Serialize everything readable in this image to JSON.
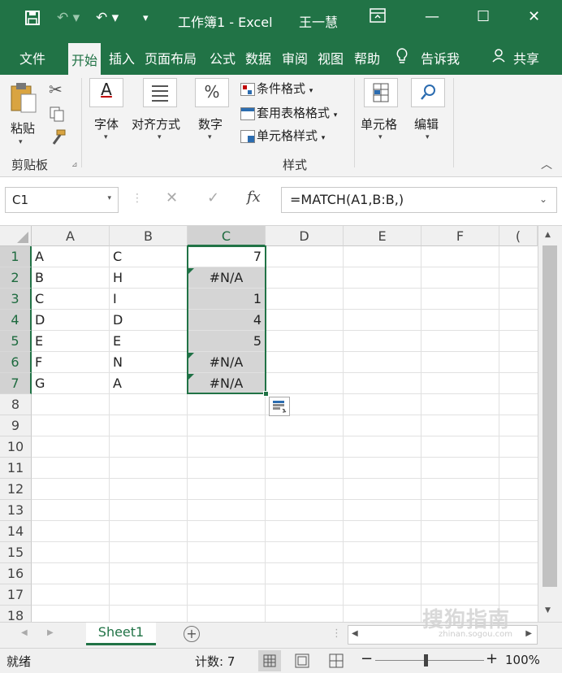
{
  "titlebar": {
    "title": "工作簿1  -  Excel",
    "user": "王一慧",
    "accent": "#217346"
  },
  "tabs": [
    {
      "label": "文件"
    },
    {
      "label": "开始"
    },
    {
      "label": "插入"
    },
    {
      "label": "页面布局"
    },
    {
      "label": "公式"
    },
    {
      "label": "数据"
    },
    {
      "label": "审阅"
    },
    {
      "label": "视图"
    },
    {
      "label": "帮助"
    },
    {
      "label": "告诉我"
    },
    {
      "label": "共享"
    }
  ],
  "ribbon": {
    "paste": "粘贴",
    "clipboard": "剪贴板",
    "font": "字体",
    "align": "对齐方式",
    "number": "数字",
    "cond_format": "条件格式",
    "table_format": "套用表格格式",
    "cell_style": "单元格样式",
    "styles": "样式",
    "cells": "单元格",
    "edit": "编辑"
  },
  "formula_bar": {
    "name_box": "C1",
    "formula": "=MATCH(A1,B:B,)"
  },
  "columns": [
    "A",
    "B",
    "C",
    "D",
    "E",
    "F",
    "("
  ],
  "rows": [
    "1",
    "2",
    "3",
    "4",
    "5",
    "6",
    "7",
    "8",
    "9",
    "10",
    "11",
    "12",
    "13",
    "14",
    "15",
    "16",
    "17",
    "18"
  ],
  "cells": {
    "A": [
      "A",
      "B",
      "C",
      "D",
      "E",
      "F",
      "G"
    ],
    "B": [
      "C",
      "H",
      "I",
      "D",
      "E",
      "N",
      "A"
    ],
    "C": [
      "7",
      "#N/A",
      "1",
      "4",
      "5",
      "#N/A",
      "#N/A"
    ]
  },
  "sheet_tab": "Sheet1",
  "status": {
    "ready": "就绪",
    "count": "计数: 7",
    "zoom": "100%"
  },
  "watermark": "搜狗指南",
  "watermark_url": "zhinan.sogou.com"
}
